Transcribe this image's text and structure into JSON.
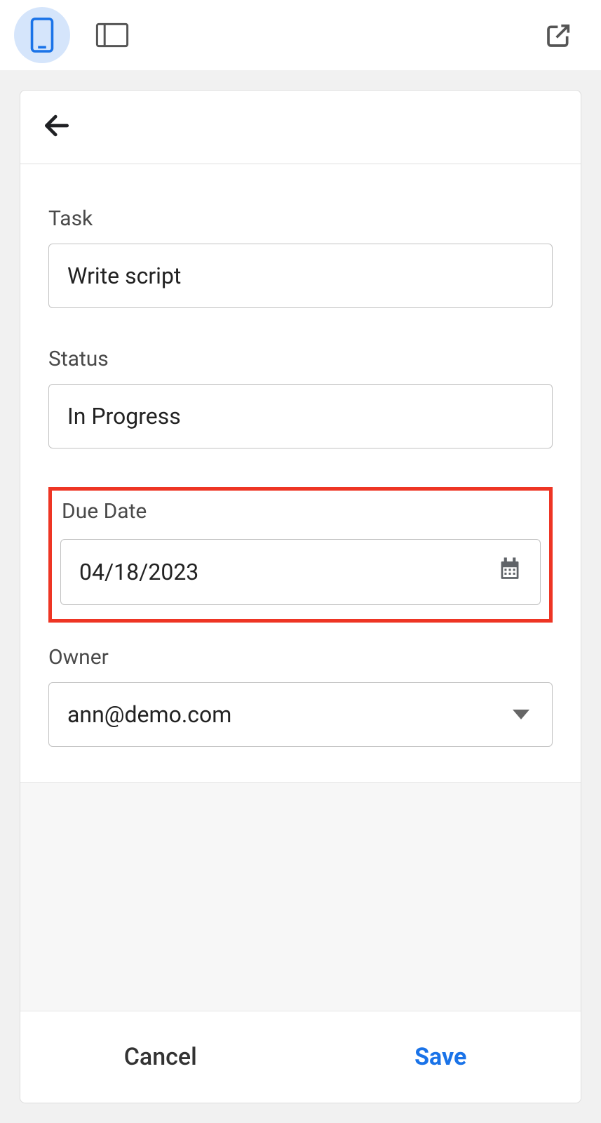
{
  "toolbar": {
    "mobile_active": true
  },
  "form": {
    "task_label": "Task",
    "task_value": "Write script",
    "status_label": "Status",
    "status_value": "In Progress",
    "due_date_label": "Due Date",
    "due_date_value": "04/18/2023",
    "owner_label": "Owner",
    "owner_value": "ann@demo.com"
  },
  "footer": {
    "cancel_label": "Cancel",
    "save_label": "Save"
  }
}
